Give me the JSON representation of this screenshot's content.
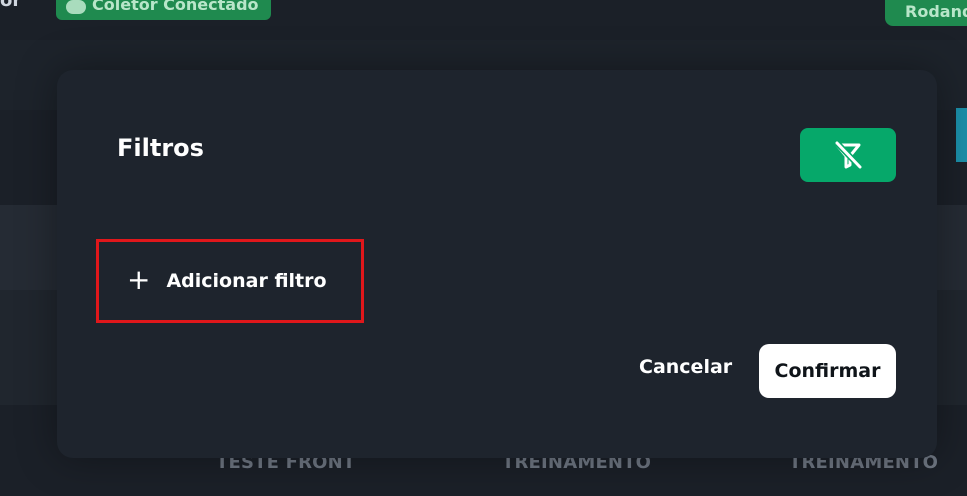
{
  "background": {
    "logo_fragment": "or",
    "connected_badge": "Coletor Conectado",
    "running_badge": "Rodando",
    "columns": [
      "TESTE FRONT",
      "TREINAMENTO",
      "TREINAMENTO"
    ]
  },
  "modal": {
    "title": "Filtros",
    "clear_filters_icon": "filter-off-icon",
    "add_filter_label": "Adicionar filtro",
    "add_filter_icon": "plus-icon",
    "cancel_label": "Cancelar",
    "confirm_label": "Confirmar"
  },
  "colors": {
    "accent_green": "#06a86a",
    "badge_green": "#1f8a4f",
    "highlight_red": "#e0171b",
    "modal_bg": "#1e242d"
  }
}
